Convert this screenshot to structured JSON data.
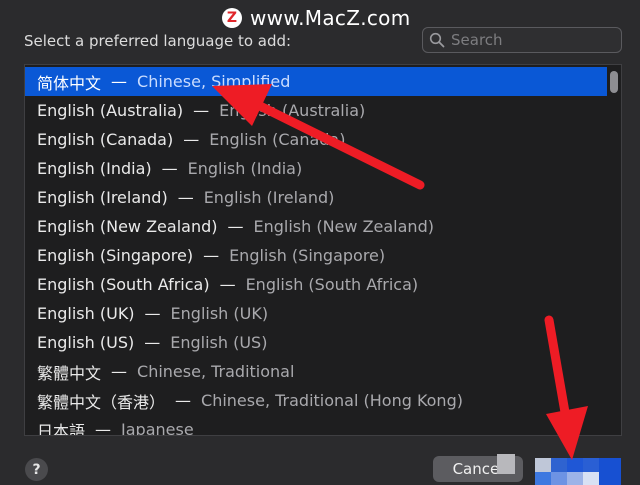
{
  "watermark": {
    "logo_letter": "Z",
    "text": "www.MacZ.com"
  },
  "dialog": {
    "prompt": "Select a preferred language to add:",
    "search_placeholder": "Search",
    "languages": [
      {
        "native": "简体中文",
        "english": "Chinese, Simplified",
        "selected": true
      },
      {
        "native": "English (Australia)",
        "english": "English (Australia)"
      },
      {
        "native": "English (Canada)",
        "english": "English (Canada)"
      },
      {
        "native": "English (India)",
        "english": "English (India)"
      },
      {
        "native": "English (Ireland)",
        "english": "English (Ireland)"
      },
      {
        "native": "English (New Zealand)",
        "english": "English (New Zealand)"
      },
      {
        "native": "English (Singapore)",
        "english": "English (Singapore)"
      },
      {
        "native": "English (South Africa)",
        "english": "English (South Africa)"
      },
      {
        "native": "English (UK)",
        "english": "English (UK)"
      },
      {
        "native": "English (US)",
        "english": "English (US)"
      },
      {
        "native": "繁體中文",
        "english": "Chinese, Traditional"
      },
      {
        "native": "繁體中文（香港）",
        "english": "Chinese, Traditional (Hong Kong)"
      },
      {
        "native": "日本語",
        "english": "Japanese"
      }
    ],
    "separator": "—",
    "help_label": "?",
    "cancel_label": "Cancel"
  },
  "colors": {
    "selection": "#0a58d6",
    "annotation_arrow": "#ee1c25",
    "background": "#2b2b2d"
  }
}
